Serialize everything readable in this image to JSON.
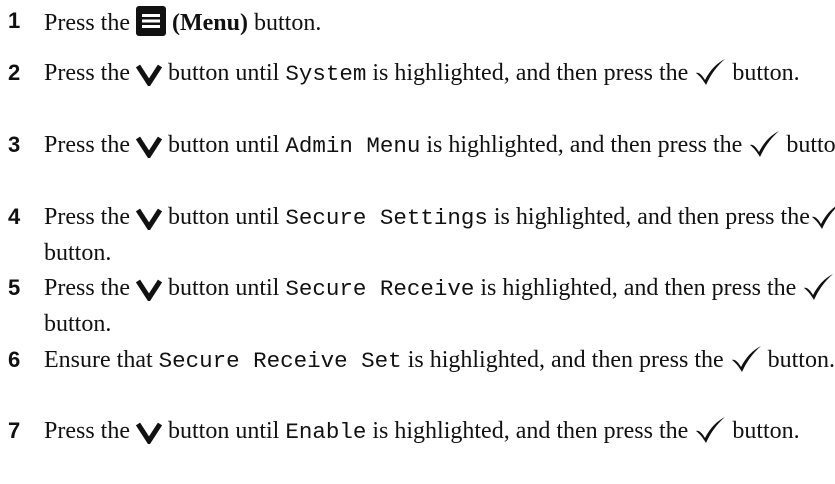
{
  "steps": [
    {
      "number": "1",
      "parts": [
        {
          "t": "text",
          "v": "Press the "
        },
        {
          "t": "icon",
          "v": "menu-icon"
        },
        {
          "t": "text",
          "v": " "
        },
        {
          "t": "bold",
          "v": "(Menu)"
        },
        {
          "t": "text",
          "v": " button."
        }
      ]
    },
    {
      "number": "2",
      "parts": [
        {
          "t": "text",
          "v": "Press the "
        },
        {
          "t": "icon",
          "v": "down-arrow-icon"
        },
        {
          "t": "text",
          "v": " button until "
        },
        {
          "t": "mono",
          "v": "System"
        },
        {
          "t": "text",
          "v": " is highlighted, and then press the "
        },
        {
          "t": "icon",
          "v": "check-icon"
        },
        {
          "t": "text",
          "v": " button."
        }
      ]
    },
    {
      "number": "3",
      "parts": [
        {
          "t": "text",
          "v": "Press the "
        },
        {
          "t": "icon",
          "v": "down-arrow-icon"
        },
        {
          "t": "text",
          "v": " button until "
        },
        {
          "t": "mono",
          "v": "Admin Menu"
        },
        {
          "t": "text",
          "v": " is highlighted, and then press the "
        },
        {
          "t": "icon",
          "v": "check-icon"
        },
        {
          "t": "text",
          "v": " button."
        }
      ]
    },
    {
      "number": "4",
      "parts": [
        {
          "t": "text",
          "v": "Press the "
        },
        {
          "t": "icon",
          "v": "down-arrow-icon"
        },
        {
          "t": "text",
          "v": " button until "
        },
        {
          "t": "mono",
          "v": "Secure Settings"
        },
        {
          "t": "text",
          "v": " is highlighted, and then press the"
        },
        {
          "t": "icon",
          "v": "check-icon"
        },
        {
          "t": "text",
          "v": " button."
        }
      ]
    },
    {
      "number": "5",
      "parts": [
        {
          "t": "text",
          "v": "Press the "
        },
        {
          "t": "icon",
          "v": "down-arrow-icon"
        },
        {
          "t": "text",
          "v": " button until "
        },
        {
          "t": "mono",
          "v": "Secure Receive"
        },
        {
          "t": "text",
          "v": " is highlighted, and then press the "
        },
        {
          "t": "icon",
          "v": "check-icon"
        },
        {
          "t": "text",
          "v": " button."
        }
      ]
    },
    {
      "number": "6",
      "parts": [
        {
          "t": "text",
          "v": "Ensure that "
        },
        {
          "t": "mono",
          "v": "Secure Receive Set"
        },
        {
          "t": "text",
          "v": " is highlighted, and then press the "
        },
        {
          "t": "icon",
          "v": "check-icon"
        },
        {
          "t": "text",
          "v": " button."
        }
      ]
    },
    {
      "number": "7",
      "parts": [
        {
          "t": "text",
          "v": "Press the "
        },
        {
          "t": "icon",
          "v": "down-arrow-icon"
        },
        {
          "t": "text",
          "v": " button until "
        },
        {
          "t": "mono",
          "v": "Enable"
        },
        {
          "t": "text",
          "v": " is highlighted, and then press the "
        },
        {
          "t": "icon",
          "v": "check-icon"
        },
        {
          "t": "text",
          "v": " button."
        }
      ]
    }
  ]
}
